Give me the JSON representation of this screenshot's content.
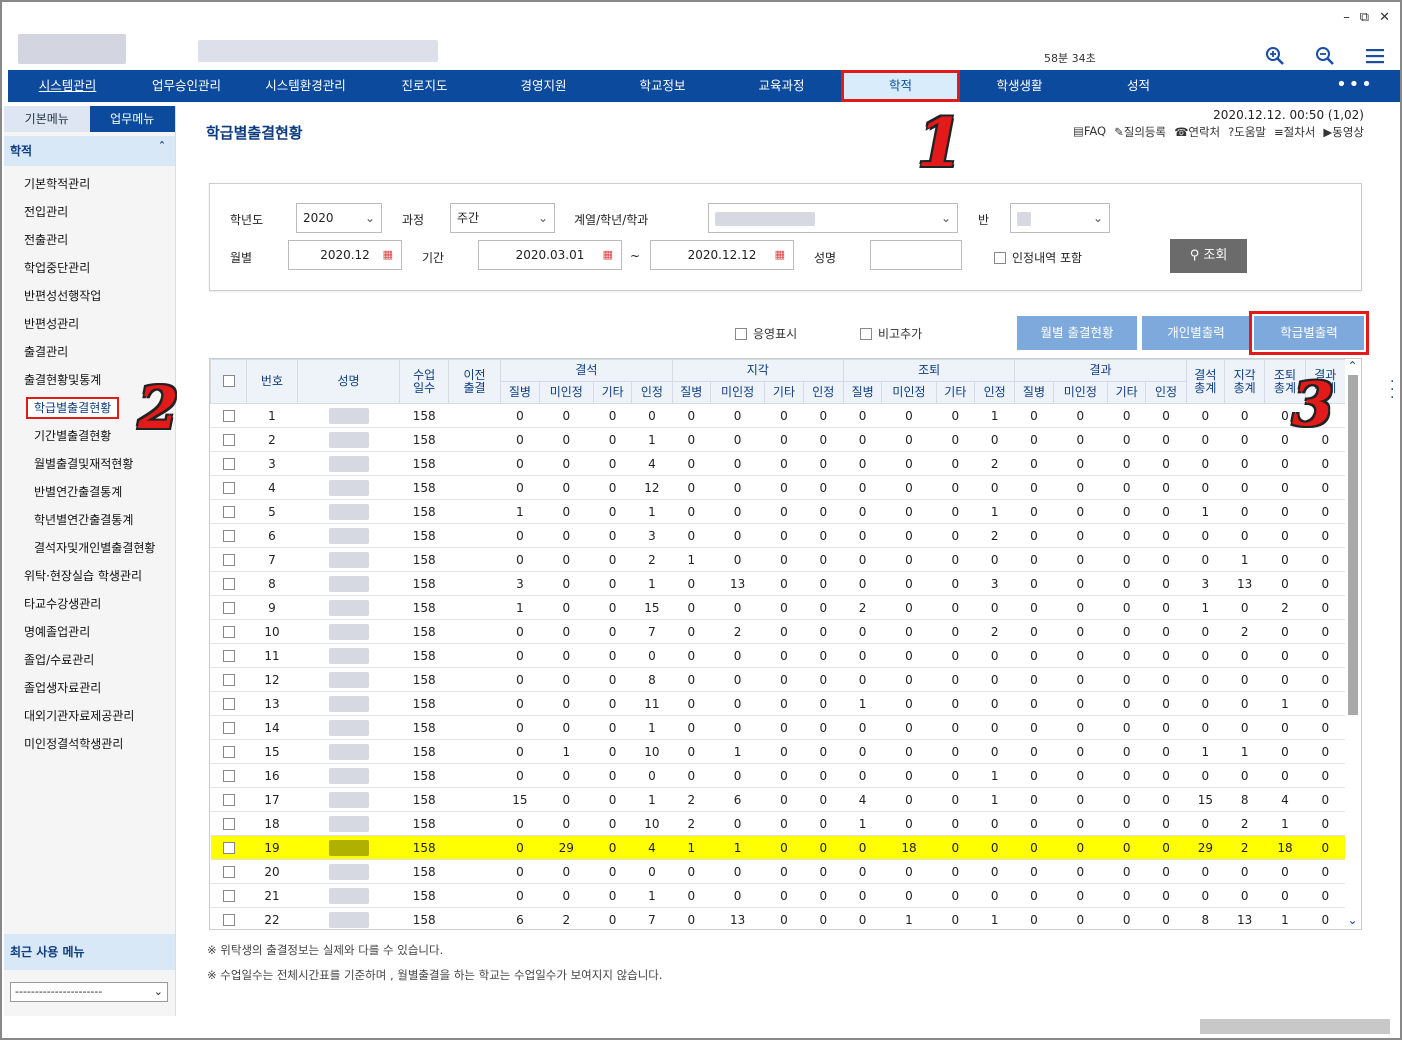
{
  "window": {
    "minimize": "–",
    "restore": "⧉",
    "close": "✕"
  },
  "session": "58분 34초",
  "header_icons": [
    "zoom-in-icon",
    "zoom-out-icon",
    "hamburger-menu-icon"
  ],
  "nav": [
    "시스템관리",
    "업무승인관리",
    "시스템환경관리",
    "진로지도",
    "경영지원",
    "학교정보",
    "교육과정",
    "학적",
    "학생생활",
    "성적"
  ],
  "nav_more": "•••",
  "sidebar": {
    "tabs": [
      "기본메뉴",
      "업무메뉴"
    ],
    "section": "학적",
    "section_mark": "ˆ",
    "items": [
      {
        "label": "기본학적관리",
        "level": 1
      },
      {
        "label": "전입관리",
        "level": 1
      },
      {
        "label": "전출관리",
        "level": 1
      },
      {
        "label": "학업중단관리",
        "level": 1
      },
      {
        "label": "반편성선행작업",
        "level": 1
      },
      {
        "label": "반편성관리",
        "level": 1
      },
      {
        "label": "출결관리",
        "level": 1
      },
      {
        "label": "출결현황및통계",
        "level": 1
      },
      {
        "label": "학급별출결현황",
        "level": 2,
        "selected": true
      },
      {
        "label": "기간별출결현황",
        "level": 2
      },
      {
        "label": "월별출결및재적현황",
        "level": 2
      },
      {
        "label": "반별연간출결통계",
        "level": 2
      },
      {
        "label": "학년별연간출결통계",
        "level": 2
      },
      {
        "label": "결석자및개인별출결현황",
        "level": 2
      },
      {
        "label": "위탁·현장실습 학생관리",
        "level": 1
      },
      {
        "label": "타교수강생관리",
        "level": 1
      },
      {
        "label": "명예졸업관리",
        "level": 1
      },
      {
        "label": "졸업/수료관리",
        "level": 1
      },
      {
        "label": "졸업생자료관리",
        "level": 1
      },
      {
        "label": "대외기관자료제공관리",
        "level": 1
      },
      {
        "label": "미인정결석학생관리",
        "level": 1
      }
    ],
    "recent_title": "최근 사용 메뉴",
    "recent_value": "----------------------"
  },
  "page": {
    "title": "학급별출결현황",
    "datetime": "2020.12.12. 00:50 (1,02)",
    "links": [
      "FAQ",
      "질의등록",
      "연락처",
      "도움말",
      "절차서",
      "동영상"
    ]
  },
  "search": {
    "year_label": "학년도",
    "year": "2020",
    "course_label": "과정",
    "course": "주간",
    "dept_label": "계열/학년/학과",
    "class_label": "반",
    "month_label": "월별",
    "month": "2020.12",
    "period_label": "기간",
    "period_from": "2020.03.01",
    "tilde": "~",
    "period_to": "2020.12.12",
    "name_label": "성명",
    "name": "",
    "include_label": "인정내역 포함",
    "search_btn": "조회"
  },
  "options": {
    "english": "응영표시",
    "remark": "비고추가"
  },
  "buttons": {
    "monthly": "월별 출결현황",
    "personal": "개인별출력",
    "class": "학급별출력"
  },
  "table": {
    "head1": [
      "번호",
      "성명",
      "수업\n일수",
      "이전\n출결",
      "결석",
      "지각",
      "조퇴",
      "결과",
      "결석\n총계",
      "지각\n총계",
      "조퇴\n총계",
      "결과\n총계"
    ],
    "sub": [
      "질병",
      "미인정",
      "기타",
      "인정"
    ],
    "rows": [
      [
        1,
        158,
        0,
        0,
        0,
        0,
        0,
        0,
        0,
        0,
        0,
        0,
        0,
        1,
        0,
        0,
        0,
        0,
        0,
        0,
        0,
        0
      ],
      [
        2,
        158,
        0,
        0,
        0,
        1,
        0,
        0,
        0,
        0,
        0,
        0,
        0,
        0,
        0,
        0,
        0,
        0,
        0,
        0,
        0,
        0
      ],
      [
        3,
        158,
        0,
        0,
        0,
        4,
        0,
        0,
        0,
        0,
        0,
        0,
        0,
        2,
        0,
        0,
        0,
        0,
        0,
        0,
        0,
        0
      ],
      [
        4,
        158,
        0,
        0,
        0,
        12,
        0,
        0,
        0,
        0,
        0,
        0,
        0,
        0,
        0,
        0,
        0,
        0,
        0,
        0,
        0,
        0
      ],
      [
        5,
        158,
        1,
        0,
        0,
        1,
        0,
        0,
        0,
        0,
        0,
        0,
        0,
        1,
        0,
        0,
        0,
        0,
        1,
        0,
        0,
        0
      ],
      [
        6,
        158,
        0,
        0,
        0,
        3,
        0,
        0,
        0,
        0,
        0,
        0,
        0,
        2,
        0,
        0,
        0,
        0,
        0,
        0,
        0,
        0
      ],
      [
        7,
        158,
        0,
        0,
        0,
        2,
        1,
        0,
        0,
        0,
        0,
        0,
        0,
        0,
        0,
        0,
        0,
        0,
        0,
        1,
        0,
        0
      ],
      [
        8,
        158,
        3,
        0,
        0,
        1,
        0,
        13,
        0,
        0,
        0,
        0,
        0,
        3,
        0,
        0,
        0,
        0,
        3,
        13,
        0,
        0
      ],
      [
        9,
        158,
        1,
        0,
        0,
        15,
        0,
        0,
        0,
        0,
        2,
        0,
        0,
        0,
        0,
        0,
        0,
        0,
        1,
        0,
        2,
        0
      ],
      [
        10,
        158,
        0,
        0,
        0,
        7,
        0,
        2,
        0,
        0,
        0,
        0,
        0,
        2,
        0,
        0,
        0,
        0,
        0,
        2,
        0,
        0
      ],
      [
        11,
        158,
        0,
        0,
        0,
        0,
        0,
        0,
        0,
        0,
        0,
        0,
        0,
        0,
        0,
        0,
        0,
        0,
        0,
        0,
        0,
        0
      ],
      [
        12,
        158,
        0,
        0,
        0,
        8,
        0,
        0,
        0,
        0,
        0,
        0,
        0,
        0,
        0,
        0,
        0,
        0,
        0,
        0,
        0,
        0
      ],
      [
        13,
        158,
        0,
        0,
        0,
        11,
        0,
        0,
        0,
        0,
        1,
        0,
        0,
        0,
        0,
        0,
        0,
        0,
        0,
        0,
        1,
        0
      ],
      [
        14,
        158,
        0,
        0,
        0,
        1,
        0,
        0,
        0,
        0,
        0,
        0,
        0,
        0,
        0,
        0,
        0,
        0,
        0,
        0,
        0,
        0
      ],
      [
        15,
        158,
        0,
        1,
        0,
        10,
        0,
        1,
        0,
        0,
        0,
        0,
        0,
        0,
        0,
        0,
        0,
        0,
        1,
        1,
        0,
        0
      ],
      [
        16,
        158,
        0,
        0,
        0,
        0,
        0,
        0,
        0,
        0,
        0,
        0,
        0,
        1,
        0,
        0,
        0,
        0,
        0,
        0,
        0,
        0
      ],
      [
        17,
        158,
        15,
        0,
        0,
        1,
        2,
        6,
        0,
        0,
        4,
        0,
        0,
        1,
        0,
        0,
        0,
        0,
        15,
        8,
        4,
        0
      ],
      [
        18,
        158,
        0,
        0,
        0,
        10,
        2,
        0,
        0,
        0,
        1,
        0,
        0,
        0,
        0,
        0,
        0,
        0,
        0,
        2,
        1,
        0
      ],
      [
        19,
        158,
        0,
        29,
        0,
        4,
        1,
        1,
        0,
        0,
        0,
        18,
        0,
        0,
        0,
        0,
        0,
        0,
        29,
        2,
        18,
        0
      ],
      [
        20,
        158,
        0,
        0,
        0,
        0,
        0,
        0,
        0,
        0,
        0,
        0,
        0,
        0,
        0,
        0,
        0,
        0,
        0,
        0,
        0,
        0
      ],
      [
        21,
        158,
        0,
        0,
        0,
        1,
        0,
        0,
        0,
        0,
        0,
        0,
        0,
        0,
        0,
        0,
        0,
        0,
        0,
        0,
        0,
        0
      ],
      [
        22,
        158,
        6,
        2,
        0,
        7,
        0,
        13,
        0,
        0,
        0,
        1,
        0,
        1,
        0,
        0,
        0,
        0,
        8,
        13,
        1,
        0
      ]
    ],
    "highlight_row": 19
  },
  "notes": [
    "※ 위탁생의 출결정보는 실제와 다를 수 있습니다.",
    "※ 수업일수는 전체시간표를 기준하며 , 월별출결을 하는 학교는 수업일수가 보여지지 않습니다."
  ],
  "annotations": [
    "1",
    "2",
    "3"
  ],
  "colors": {
    "nav": "#0c4a9e",
    "highlight": "#ffff00",
    "annotation": "#e21a1a",
    "button": "#7ea9dc"
  }
}
